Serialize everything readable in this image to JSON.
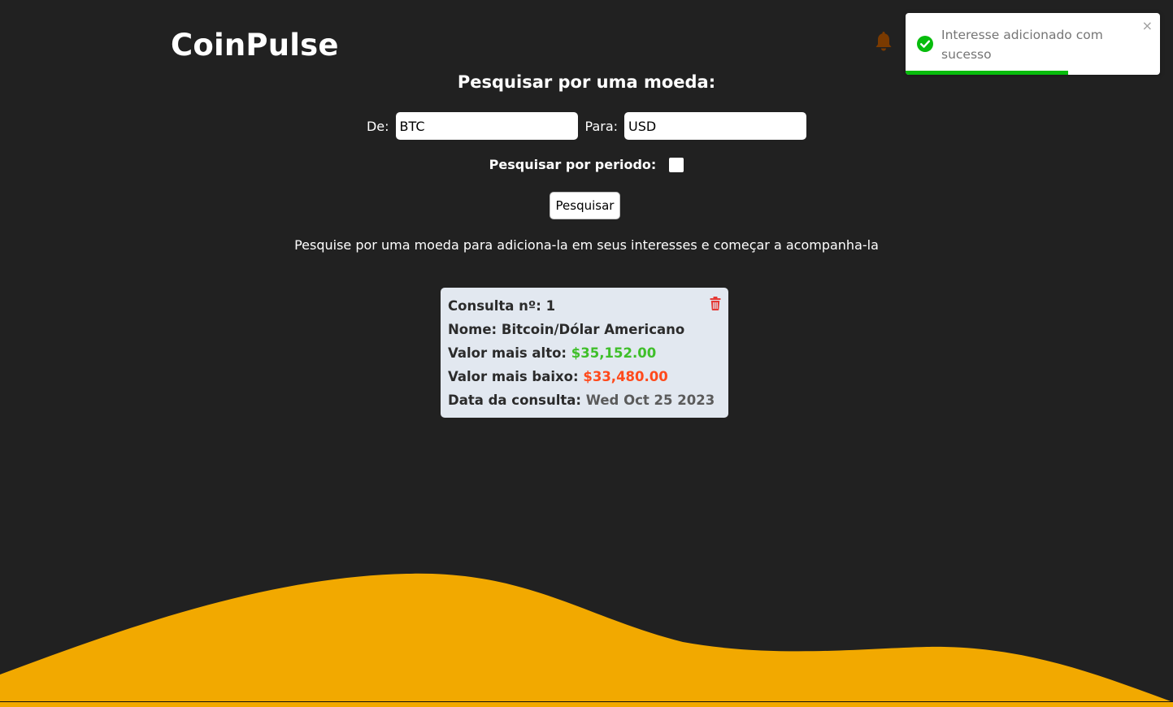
{
  "header": {
    "brand": "CoinPulse",
    "bell_icon": "bell-icon"
  },
  "search": {
    "title": "Pesquisar por uma moeda:",
    "from_label": "De:",
    "from_value": "BTC",
    "to_label": "Para:",
    "to_value": "USD",
    "period_label": "Pesquisar por periodo:",
    "period_checked": false,
    "button_label": "Pesquisar",
    "hint": "Pesquise por uma moeda para adiciona-la em seus interesses e começar a acompanha-la"
  },
  "card": {
    "query_label": "Consulta nº:",
    "query_number": "1",
    "name_label": "Nome:",
    "name_value": "Bitcoin/Dólar Americano",
    "high_label": "Valor mais alto:",
    "high_value": "$35,152.00",
    "low_label": "Valor mais baixo:",
    "low_value": "$33,480.00",
    "date_label": "Data da consulta:",
    "date_value": "Wed Oct 25 2023",
    "delete_icon": "trash-icon"
  },
  "toast": {
    "message": "Interesse adicionado com sucesso",
    "close": "×",
    "progress": 0.64,
    "icon": "check-circle-icon"
  },
  "colors": {
    "background": "#212121",
    "wave": "#f2a900",
    "bell": "#7a3a00",
    "high": "#3fbf2a",
    "low": "#ff4a1c",
    "toast_progress": "#07bc0c",
    "trash": "#e53935"
  }
}
